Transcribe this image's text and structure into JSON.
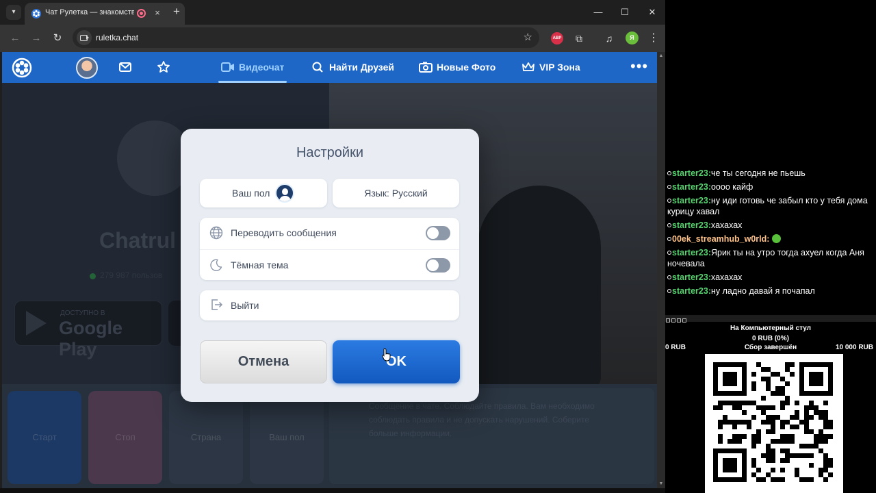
{
  "browser": {
    "tab_title": "Чат Рулетка — знакомства",
    "tab_close": "×",
    "new_tab": "+",
    "url": "ruletka.chat",
    "win_minimize": "—",
    "win_maximize": "☐",
    "win_close": "✕",
    "ext_abp_label": "ABP",
    "profile_initial": "Я"
  },
  "site": {
    "nav": {
      "items": [
        {
          "label": "Видеочат",
          "icon": "video-icon",
          "active": true
        },
        {
          "label": "Найти Друзей",
          "icon": "search-icon"
        },
        {
          "label": "Новые Фото",
          "icon": "camera-icon"
        },
        {
          "label": "VIP Зона",
          "icon": "crown-icon"
        }
      ],
      "more": "•••"
    },
    "background": {
      "brand": "Chatrul",
      "online": "279 987 пользов",
      "store_small": "ДОСТУПНО В",
      "store_big": "Google Play",
      "tiles": [
        "Старт",
        "Стоп",
        "Страна",
        "Ваш пол"
      ],
      "chat_hint": "Сообщение в чате. Соблюдайте правила. Вам необходимо соблюдать правила и не допускать нарушений. Соберите больше информации."
    }
  },
  "dialog": {
    "title": "Настройки",
    "gender_label": "Ваш пол",
    "language_label": "Язык: Русский",
    "translate_label": "Переводить сообщения",
    "translate_on": false,
    "dark_theme_label": "Тёмная тема",
    "dark_theme_on": false,
    "logout_label": "Выйти",
    "cancel_label": "Отмена",
    "ok_label": "OK"
  },
  "overlay": {
    "chat": [
      {
        "user": "starter23",
        "text": "че ты сегодня не пьешь"
      },
      {
        "user": "starter23",
        "text": "оооо кайф"
      },
      {
        "user": "starter23",
        "text": "ну иди готовь че забыл кто у тебя дома курицу хавал"
      },
      {
        "user": "starter23",
        "text": "хахахах"
      },
      {
        "user": "00ek_streamhub_w0rld",
        "text": "",
        "emote": true,
        "highlight": true
      },
      {
        "user": "starter23",
        "text": "Ярик ты на утро тогда ахуел когда Аня ночевала"
      },
      {
        "user": "starter23",
        "text": "хахахах"
      },
      {
        "user": "starter23",
        "text": "ну ладно давай я почапал"
      }
    ],
    "donation": {
      "title": "На Компьютерный стул",
      "progress": "0 RUB (0%)",
      "progress_fraction": 0,
      "min": "0 RUB",
      "status": "Сбор завершён",
      "max": "10 000 RUB"
    }
  }
}
